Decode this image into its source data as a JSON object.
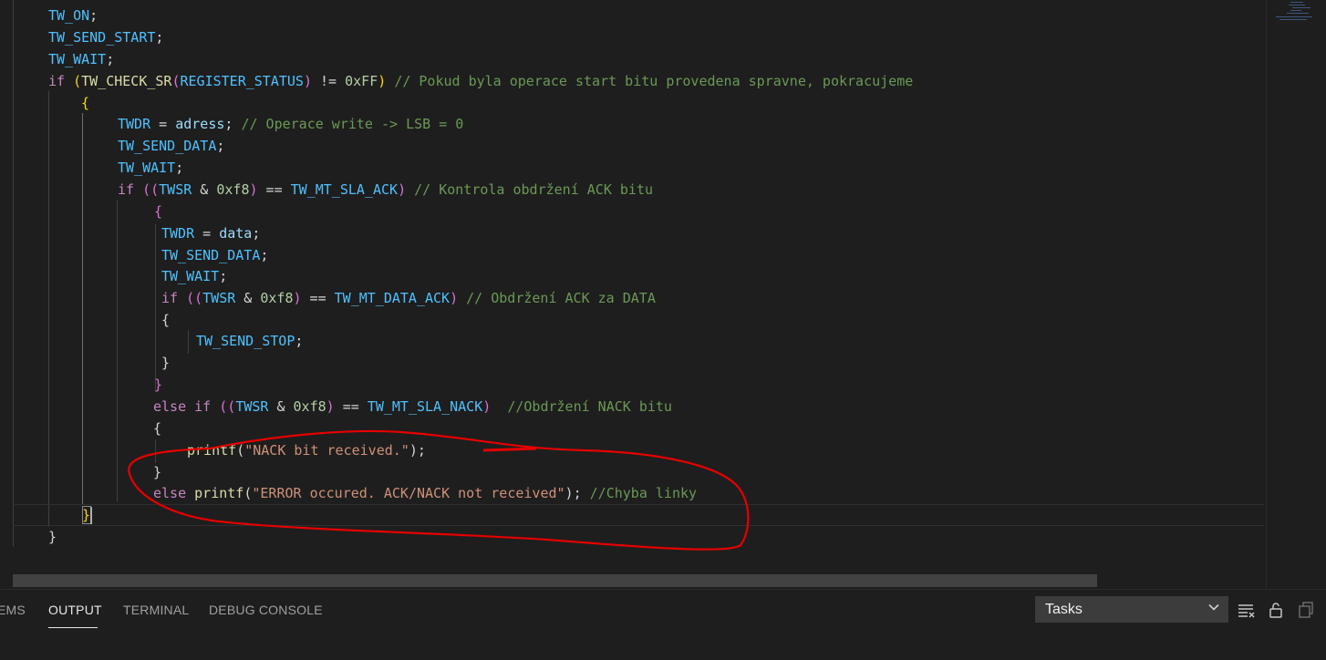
{
  "editor": {
    "lines": [
      [
        [
          "TW_ON",
          "t-m"
        ],
        [
          ";",
          "t-p"
        ]
      ],
      [
        [
          "TW_SEND_START",
          "t-m"
        ],
        [
          ";",
          "t-p"
        ]
      ],
      [
        [
          "TW_WAIT",
          "t-m"
        ],
        [
          ";",
          "t-p"
        ]
      ],
      [
        [
          "if",
          "t-k"
        ],
        [
          " ",
          "t-p"
        ],
        [
          "(",
          "t-b"
        ],
        [
          "TW_CHECK_SR",
          "t-f"
        ],
        [
          "(",
          "t-b2"
        ],
        [
          "REGISTER_STATUS",
          "t-m"
        ],
        [
          ")",
          "t-b2"
        ],
        [
          " != ",
          "t-p"
        ],
        [
          "0xFF",
          "t-n"
        ],
        [
          ")",
          "t-b"
        ],
        [
          " ",
          "t-p"
        ],
        [
          "// Pokud byla operace start bitu provedena spravne, pokracujeme",
          "t-c"
        ]
      ],
      [
        [
          "{",
          "t-b"
        ]
      ],
      [
        [
          "TWDR",
          "t-m"
        ],
        [
          " = ",
          "t-p"
        ],
        [
          "adress",
          "t-v"
        ],
        [
          "; ",
          "t-p"
        ],
        [
          "// Operace write -> LSB = 0",
          "t-c"
        ]
      ],
      [
        [
          "TW_SEND_DATA",
          "t-m"
        ],
        [
          ";",
          "t-p"
        ]
      ],
      [
        [
          "TW_WAIT",
          "t-m"
        ],
        [
          ";",
          "t-p"
        ]
      ],
      [
        [
          "if",
          "t-k"
        ],
        [
          " ",
          "t-p"
        ],
        [
          "((",
          "t-b2"
        ],
        [
          "TWSR",
          "t-m"
        ],
        [
          " & ",
          "t-p"
        ],
        [
          "0xf8",
          "t-n"
        ],
        [
          ")",
          "t-b2"
        ],
        [
          " == ",
          "t-p"
        ],
        [
          "TW_MT_SLA_ACK",
          "t-m"
        ],
        [
          ")",
          "t-b2"
        ],
        [
          " ",
          "t-p"
        ],
        [
          "// Kontrola obdržení ACK bitu",
          "t-c"
        ]
      ],
      [
        [
          "{",
          "t-b2"
        ]
      ],
      [
        [
          "TWDR",
          "t-m"
        ],
        [
          " = ",
          "t-p"
        ],
        [
          "data",
          "t-v"
        ],
        [
          ";",
          "t-p"
        ]
      ],
      [
        [
          "TW_SEND_DATA",
          "t-m"
        ],
        [
          ";",
          "t-p"
        ]
      ],
      [
        [
          "TW_WAIT",
          "t-m"
        ],
        [
          ";",
          "t-p"
        ]
      ],
      [
        [
          "if",
          "t-k"
        ],
        [
          " ",
          "t-p"
        ],
        [
          "((",
          "t-b2"
        ],
        [
          "TWSR",
          "t-m"
        ],
        [
          " & ",
          "t-p"
        ],
        [
          "0xf8",
          "t-n"
        ],
        [
          ")",
          "t-b2"
        ],
        [
          " == ",
          "t-p"
        ],
        [
          "TW_MT_DATA_ACK",
          "t-m"
        ],
        [
          ")",
          "t-b2"
        ],
        [
          " ",
          "t-p"
        ],
        [
          "// Obdržení ACK za DATA",
          "t-c"
        ]
      ],
      [
        [
          "{",
          "t-p"
        ]
      ],
      [
        [
          "TW_SEND_STOP",
          "t-m"
        ],
        [
          ";",
          "t-p"
        ]
      ],
      [
        [
          "}",
          "t-p"
        ]
      ],
      [
        [
          "}",
          "t-b2"
        ]
      ],
      [
        [
          "else",
          "t-k"
        ],
        [
          " ",
          "t-p"
        ],
        [
          "if",
          "t-k"
        ],
        [
          " ",
          "t-p"
        ],
        [
          "((",
          "t-b2"
        ],
        [
          "TWSR",
          "t-m"
        ],
        [
          " & ",
          "t-p"
        ],
        [
          "0xf8",
          "t-n"
        ],
        [
          ")",
          "t-b2"
        ],
        [
          " == ",
          "t-p"
        ],
        [
          "TW_MT_SLA_NACK",
          "t-m"
        ],
        [
          ")",
          "t-b2"
        ],
        [
          "  ",
          "t-p"
        ],
        [
          "//Obdržení NACK bitu",
          "t-c"
        ]
      ],
      [
        [
          "{",
          "t-p"
        ]
      ],
      [
        [
          "printf",
          "t-f"
        ],
        [
          "(",
          "t-p"
        ],
        [
          "\"NACK bit received.\"",
          "t-s"
        ],
        [
          ");",
          "t-p"
        ]
      ],
      [
        [
          "}",
          "t-p"
        ]
      ],
      [
        [
          "else",
          "t-k"
        ],
        [
          " ",
          "t-p"
        ],
        [
          "printf",
          "t-f"
        ],
        [
          "(",
          "t-p"
        ],
        [
          "\"ERROR occured. ACK/NACK not received\"",
          "t-s"
        ],
        [
          "); ",
          "t-p"
        ],
        [
          "//Chyba linky",
          "t-c"
        ]
      ],
      [
        [
          "}",
          "t-b"
        ]
      ],
      [
        [
          "}",
          "t-p"
        ]
      ]
    ]
  },
  "panel": {
    "tabs": [
      "EMS",
      "OUTPUT",
      "TERMINAL",
      "DEBUG CONSOLE"
    ],
    "active_tab": "OUTPUT",
    "task_select": "Tasks",
    "icons": [
      "list-filter-icon",
      "lock-icon",
      "copy-icon"
    ]
  },
  "colors": {
    "background": "#1e1e1e",
    "annotation": "#e60000"
  }
}
